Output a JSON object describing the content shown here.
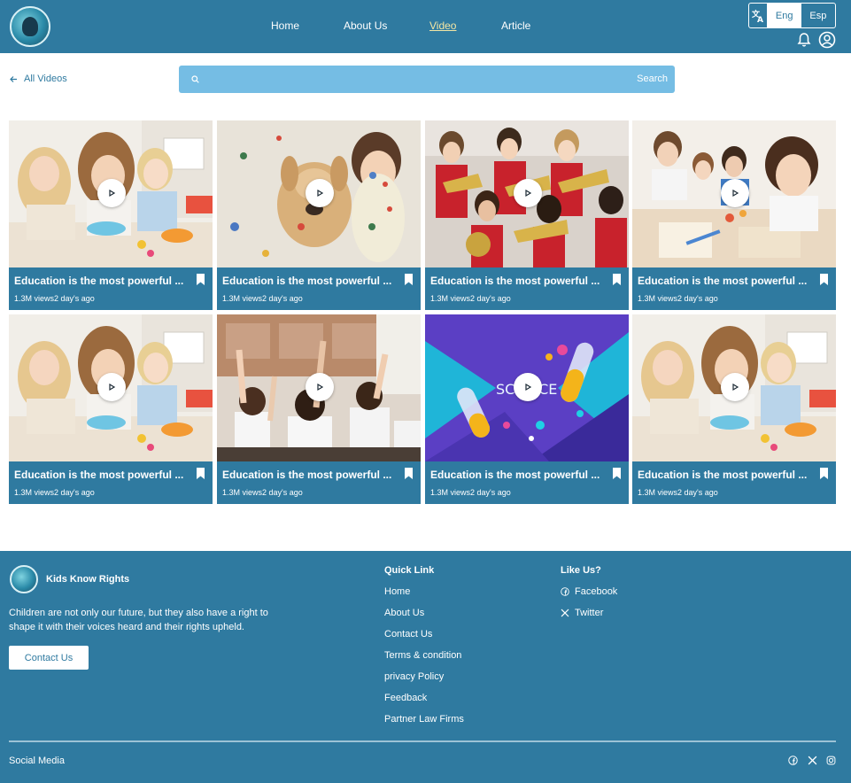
{
  "header": {
    "nav": [
      {
        "label": "Home",
        "active": false
      },
      {
        "label": "About Us",
        "active": false
      },
      {
        "label": "Video",
        "active": true
      },
      {
        "label": "Article",
        "active": false
      }
    ],
    "language": {
      "icon": "translate-icon",
      "eng": "Eng",
      "esp": "Esp",
      "selected": "Eng"
    },
    "icons": [
      "bell-icon",
      "user-account-icon"
    ]
  },
  "toolbar": {
    "back_label": "All Videos",
    "search_placeholder": "",
    "search_button": "Search"
  },
  "videos": [
    {
      "title": "Education is the most powerful ...",
      "views": "1.3M views",
      "age": "2 day's ago",
      "scene": "girls-crafting"
    },
    {
      "title": "Education is the most powerful ...",
      "views": "1.3M views",
      "age": "2 day's ago",
      "scene": "painted-child-dog"
    },
    {
      "title": "Education is the most powerful ...",
      "views": "1.3M views",
      "age": "2 day's ago",
      "scene": "school-band"
    },
    {
      "title": "Education is the most powerful ...",
      "views": "1.3M views",
      "age": "2 day's ago",
      "scene": "kids-drawing"
    },
    {
      "title": "Education is the most powerful ...",
      "views": "1.3M views",
      "age": "2 day's ago",
      "scene": "girls-crafting"
    },
    {
      "title": "Education is the most powerful ...",
      "views": "1.3M views",
      "age": "2 day's ago",
      "scene": "raised-hands-classroom"
    },
    {
      "title": "Education is the most powerful ...",
      "views": "1.3M views",
      "age": "2 day's ago",
      "scene": "science-illustration"
    },
    {
      "title": "Education is the most powerful ...",
      "views": "1.3M views",
      "age": "2 day's ago",
      "scene": "girls-crafting"
    }
  ],
  "science_label": "SCIENCE",
  "footer": {
    "brand": "Kids Know Rights",
    "tagline": "Children are not only our future, but they also have a right to shape it with their voices heard and their rights upheld.",
    "contact_button": "Contact Us",
    "quick_link_heading": "Quick Link",
    "quick_links": [
      "Home",
      "About Us",
      "Contact Us",
      "Terms & condition",
      "privacy Policy",
      "Feedback",
      "Partner Law Firms"
    ],
    "like_heading": "Like Us?",
    "like_links": [
      {
        "label": "Facebook",
        "icon": "facebook-icon"
      },
      {
        "label": "Twitter",
        "icon": "x-twitter-icon"
      }
    ],
    "social_label": "Social Media",
    "social_icons": [
      "facebook-icon",
      "x-twitter-icon",
      "instagram-icon"
    ]
  },
  "colors": {
    "primary": "#2f7aa0",
    "search": "#75bde4",
    "active_nav": "#f3e6a4"
  }
}
